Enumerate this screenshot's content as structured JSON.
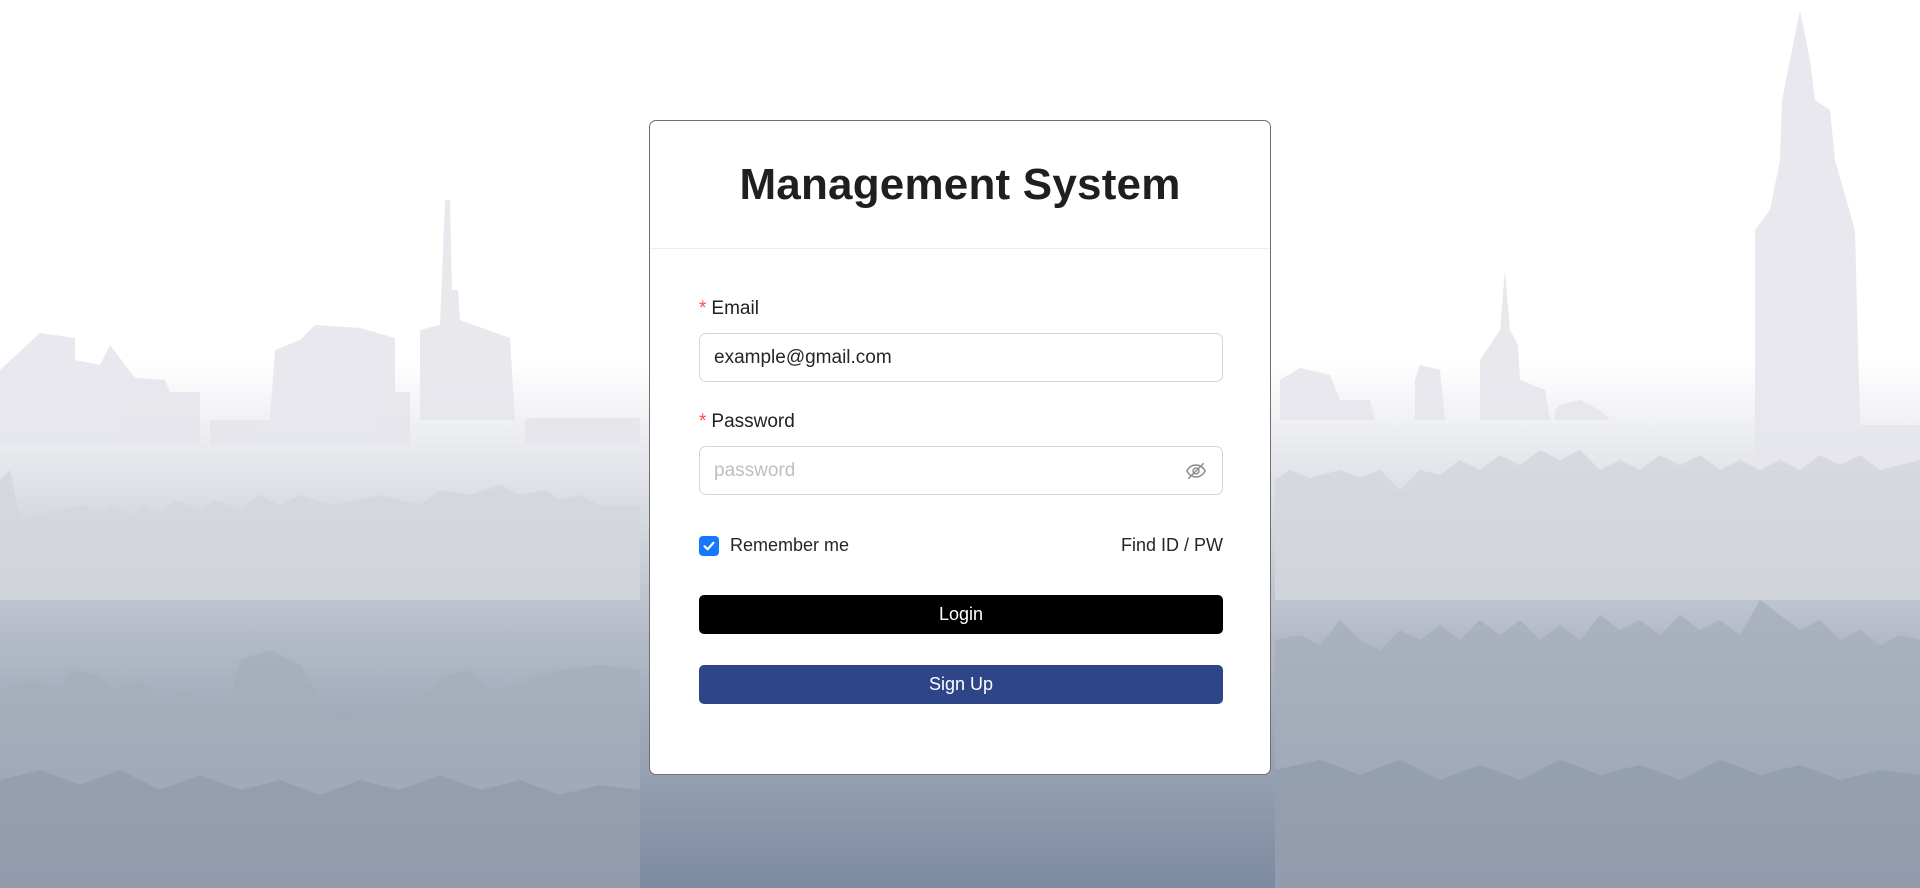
{
  "card": {
    "title": "Management System"
  },
  "form": {
    "required_mark": "*",
    "email": {
      "label": "Email",
      "value": "example@gmail.com",
      "placeholder": ""
    },
    "password": {
      "label": "Password",
      "value": "",
      "placeholder": "password",
      "toggle_icon": "eye-hidden-icon"
    },
    "remember": {
      "label": "Remember me",
      "checked": true,
      "check_icon": "check-icon"
    },
    "find_link": "Find ID / PW",
    "login_button": "Login",
    "signup_button": "Sign Up"
  },
  "colors": {
    "login_bg": "#000000",
    "signup_bg": "#2e4588",
    "checkbox": "#1677ff",
    "required": "#ff4d4f"
  },
  "background_icon": "city-skyline"
}
